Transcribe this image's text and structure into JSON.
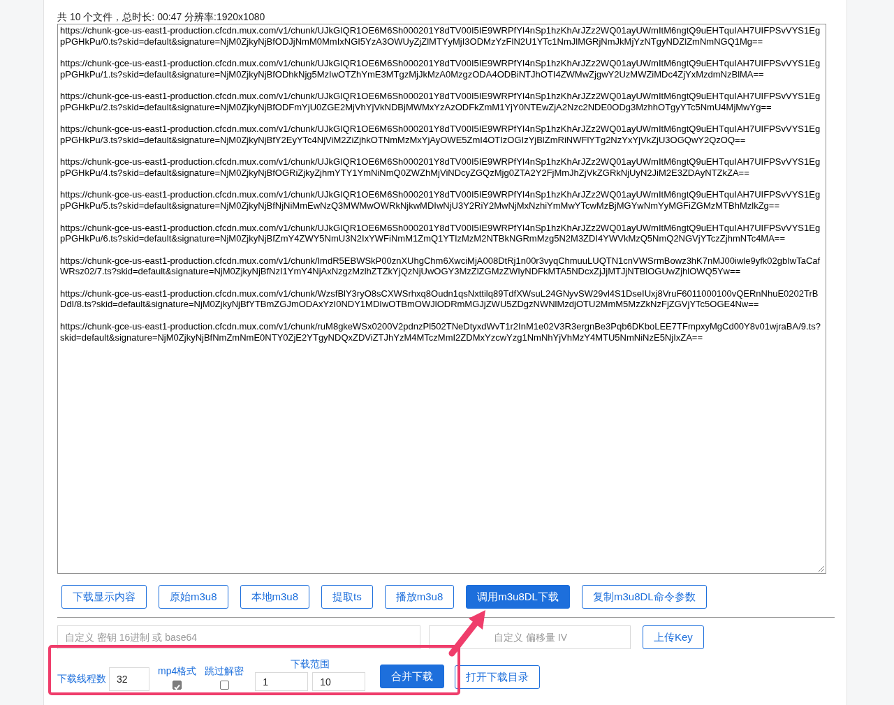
{
  "summary": "共 10 个文件，总时长: 00:47 分辨率:1920x1080",
  "urls": [
    "https://chunk-gce-us-east1-production.cfcdn.mux.com/v1/chunk/UJkGIQR1OE6M6Sh000201Y8dTV00I5IE9WRPfYI4nSp1hzKhArJZz2WQ01ayUWmItM6ngtQ9uEHTquIAH7UIFPSvVYS1EgpPGHkPu/0.ts?skid=default&signature=NjM0ZjkyNjBfODJjNmM0MmIxNGI5YzA3OWUyZjZlMTYyMjI3ODMzYzFlN2U1YTc1NmJlMGRjNmJkMjYzNTgyNDZlZmNmNGQ1Mg==",
    "https://chunk-gce-us-east1-production.cfcdn.mux.com/v1/chunk/UJkGIQR1OE6M6Sh000201Y8dTV00I5IE9WRPfYI4nSp1hzKhArJZz2WQ01ayUWmItM6ngtQ9uEHTquIAH7UIFPSvVYS1EgpPGHkPu/1.ts?skid=default&signature=NjM0ZjkyNjBfODhkNjg5MzIwOTZhYmE3MTgzMjJkMzA0MzgzODA4ODBiNTJhOTI4ZWMwZjgwY2UzMWZiMDc4ZjYxMzdmNzBlMA==",
    "https://chunk-gce-us-east1-production.cfcdn.mux.com/v1/chunk/UJkGIQR1OE6M6Sh000201Y8dTV00I5IE9WRPfYI4nSp1hzKhArJZz2WQ01ayUWmItM6ngtQ9uEHTquIAH7UIFPSvVYS1EgpPGHkPu/2.ts?skid=default&signature=NjM0ZjkyNjBfODFmYjU0ZGE2MjVhYjVkNDBjMWMxYzAzODFkZmM1YjY0NTEwZjA2Nzc2NDE0ODg3MzhhOTgyYTc5NmU4MjMwYg==",
    "https://chunk-gce-us-east1-production.cfcdn.mux.com/v1/chunk/UJkGIQR1OE6M6Sh000201Y8dTV00I5IE9WRPfYI4nSp1hzKhArJZz2WQ01ayUWmItM6ngtQ9uEHTquIAH7UIFPSvVYS1EgpPGHkPu/3.ts?skid=default&signature=NjM0ZjkyNjBfY2EyYTc4NjViM2ZiZjhkOTNmMzMxYjAyOWE5ZmI4OTIzOGIzYjBlZmRiNWFlYTg2NzYxYjVkZjU3OGQwY2QzOQ==",
    "https://chunk-gce-us-east1-production.cfcdn.mux.com/v1/chunk/UJkGIQR1OE6M6Sh000201Y8dTV00I5IE9WRPfYI4nSp1hzKhArJZz2WQ01ayUWmItM6ngtQ9uEHTquIAH7UIFPSvVYS1EgpPGHkPu/4.ts?skid=default&signature=NjM0ZjkyNjBfOGRiZjkyZjhmYTY1YmNiNmQ0ZWZhMjViNDcyZGQzMjg0ZTA2Y2FjMmJhZjVkZGRkNjUyN2JiM2E3ZDAyNTZkZA==",
    "https://chunk-gce-us-east1-production.cfcdn.mux.com/v1/chunk/UJkGIQR1OE6M6Sh000201Y8dTV00I5IE9WRPfYI4nSp1hzKhArJZz2WQ01ayUWmItM6ngtQ9uEHTquIAH7UIFPSvVYS1EgpPGHkPu/5.ts?skid=default&signature=NjM0ZjkyNjBfNjNiMmEwNzQ3MWMwOWRkNjkwMDIwNjU3Y2RiY2MwNjMxNzhiYmMwYTcwMzBjMGYwNmYyMGFiZGMzMTBhMzlkZg==",
    "https://chunk-gce-us-east1-production.cfcdn.mux.com/v1/chunk/UJkGIQR1OE6M6Sh000201Y8dTV00I5IE9WRPfYI4nSp1hzKhArJZz2WQ01ayUWmItM6ngtQ9uEHTquIAH7UIFPSvVYS1EgpPGHkPu/6.ts?skid=default&signature=NjM0ZjkyNjBfZmY4ZWY5NmU3N2IxYWFiNmM1ZmQ1YTIzMzM2NTBkNGRmMzg5N2M3ZDI4YWVkMzQ5NmQ2NGVjYTczZjhmNTc4MA==",
    "https://chunk-gce-us-east1-production.cfcdn.mux.com/v1/chunk/ImdR5EBWSkP00znXUhgChm6XwciMjA008DtRj1n00r3vyqChmuuLUQTN1cnVWSrmBowz3hK7nMJ00iwle9yfk02gbIwTaCafWRsz02/7.ts?skid=default&signature=NjM0ZjkyNjBfNzI1YmY4NjAxNzgzMzlhZTZkYjQzNjUwOGY3MzZlZGMzZWIyNDFkMTA5NDcxZjJjMTJjNTBlOGUwZjhlOWQ5Yw==",
    "https://chunk-gce-us-east1-production.cfcdn.mux.com/v1/chunk/WzsfBlY3ryO8sCXWSrhxq8Oudn1qsNxttilq89TdfXWsuL24GNyvSW29vl4S1DseIUxj8VruF6011000100vQERnNhuE0202TrBDdI/8.ts?skid=default&signature=NjM0ZjkyNjBfYTBmZGJmODAxYzI0NDY1MDIwOTBmOWJlODRmMGJjZWU5ZDgzNWNlMzdjOTU2MmM5MzZkNzFjZGVjYTc5OGE4Nw==",
    "https://chunk-gce-us-east1-production.cfcdn.mux.com/v1/chunk/ruM8gkeWSx0200V2pdnzPl502TNeDtyxdWvT1r2InM1e02V3R3ergnBe3Pqb6DKboLEE7TFmpxyMgCd00Y8v01wjraBA/9.ts?skid=default&signature=NjM0ZjkyNjBfNmZmNmE0NTY0ZjE2YTgyNDQxZDViZTJhYzM4MTczMmI2ZDMxYzcwYzg1NmNhYjVhMzY4MTU5NmNiNzE5NjIxZA=="
  ],
  "buttons": [
    {
      "label": "下载显示内容",
      "kind": "outline"
    },
    {
      "label": "原始m3u8",
      "kind": "outline"
    },
    {
      "label": "本地m3u8",
      "kind": "outline"
    },
    {
      "label": "提取ts",
      "kind": "outline"
    },
    {
      "label": "播放m3u8",
      "kind": "outline"
    },
    {
      "label": "调用m3u8DL下载",
      "kind": "primary"
    },
    {
      "label": "复制m3u8DL命令参数",
      "kind": "outline"
    }
  ],
  "key_field": {
    "placeholder": "自定义 密钥 16进制 或 base64"
  },
  "iv_field": {
    "placeholder": "自定义 偏移量 IV"
  },
  "upload_button": {
    "label": "上传Key",
    "kind": "outline"
  },
  "threads": {
    "label": "下载线程数",
    "value": "32"
  },
  "mp4": {
    "label": "mp4格式",
    "checked": true
  },
  "skip_decrypt": {
    "label": "跳过解密",
    "checked": false
  },
  "range": {
    "label": "下载范围",
    "from": "1",
    "to": "10"
  },
  "merge_button": {
    "label": "合并下载",
    "kind": "primary"
  },
  "open_dir_button": {
    "label": "打开下载目录",
    "kind": "outline"
  }
}
